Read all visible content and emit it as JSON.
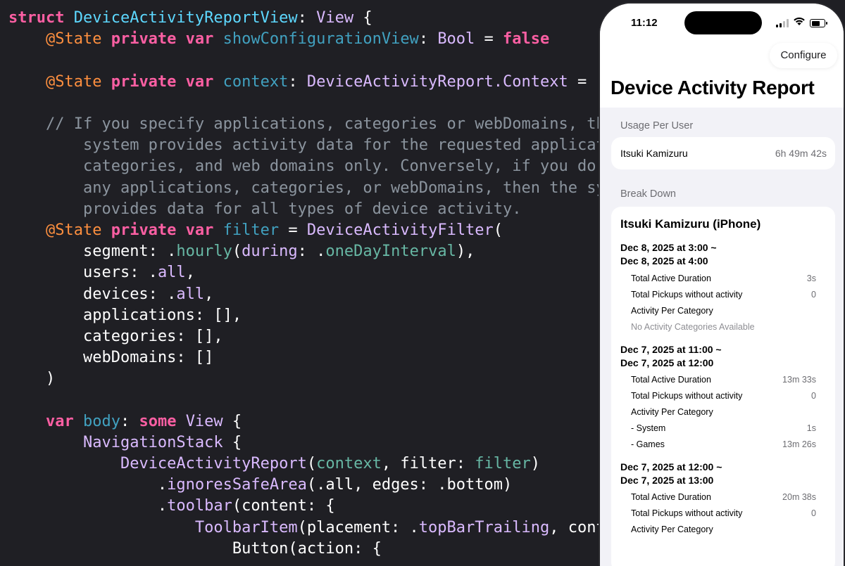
{
  "code": {
    "l1": {
      "kw": "struct ",
      "name": "DeviceActivityReportView",
      "colon": ": ",
      "type": "View",
      "brace": " {"
    },
    "l2": {
      "attr": "@State ",
      "kw1": "private ",
      "kw2": "var ",
      "name": "showConfigurationView",
      "colon": ": ",
      "type": "Bool",
      "eq": " = ",
      "val": "false"
    },
    "l4": {
      "attr": "@State ",
      "kw1": "private ",
      "kw2": "var ",
      "name": "context",
      "colon": ": ",
      "type": "DeviceActivityReport.Context",
      "eq": " = ."
    },
    "l6": "// If you specify applications, categories or webDomains, th",
    "l7": "    system provides activity data for the requested applicat",
    "l8": "    categories, and web domains only. Conversely, if you do ",
    "l9": "    any applications, categories, or webDomains, then the sy",
    "l10": "    provides data for all types of device activity.",
    "l11": {
      "attr": "@State ",
      "kw1": "private ",
      "kw2": "var ",
      "name": "filter",
      "eq": " = ",
      "type": "DeviceActivityFilter",
      "paren": "("
    },
    "l12": {
      "a": "    segment: .",
      "fn": "hourly",
      "b": "(",
      "c": "during",
      "d": ": .",
      "e": "oneDayInterval",
      "f": "),"
    },
    "l13": {
      "a": "    users: .",
      "b": "all",
      "c": ","
    },
    "l14": {
      "a": "    devices: .",
      "b": "all",
      "c": ","
    },
    "l15": "    applications: [],",
    "l16": "    categories: [],",
    "l17": "    webDomains: []",
    "l18": ")",
    "l20": {
      "kw": "var ",
      "name": "body",
      "colon": ": ",
      "kw2": "some ",
      "type": "View",
      "brace": " {"
    },
    "l21": {
      "pad": "    ",
      "type": "NavigationStack",
      "brace": " {"
    },
    "l22": {
      "pad": "        ",
      "type": "DeviceActivityReport",
      "a": "(",
      "b": "context",
      "c": ", filter: ",
      "d": "filter",
      "e": ")"
    },
    "l23": {
      "pad": "            .",
      "fn": "ignoresSafeArea",
      "a": "(.all, edges: .bottom)"
    },
    "l24": {
      "pad": "            .",
      "fn": "toolbar",
      "a": "(content: {"
    },
    "l25": {
      "pad": "                ",
      "type": "ToolbarItem",
      "a": "(placement: .",
      "b": "topBarTrailing",
      "c": ", conten"
    },
    "l26": {
      "pad": "                    ",
      "a": "Button(action: {"
    }
  },
  "phone": {
    "time": "11:12",
    "configure": "Configure",
    "title": "Device Activity Report",
    "usage_header": "Usage Per User",
    "user_name": "Itsuki Kamizuru",
    "user_total": "6h 49m 42s",
    "breakdown_header": "Break Down",
    "device_title": "Itsuki Kamizuru (iPhone)",
    "segments": [
      {
        "range1": "Dec 8, 2025 at 3:00 ~",
        "range2": "Dec 8, 2025 at 4:00",
        "active_label": "Total Active Duration",
        "active": "3s",
        "pickups_label": "Total Pickups without activity",
        "pickups": "0",
        "category_label": "Activity Per Category",
        "empty": "No Activity Categories Available"
      },
      {
        "range1": "Dec 7, 2025 at 11:00 ~",
        "range2": "Dec 7, 2025 at 12:00",
        "active_label": "Total Active Duration",
        "active": "13m 33s",
        "pickups_label": "Total Pickups without activity",
        "pickups": "0",
        "category_label": "Activity Per Category",
        "categories": [
          {
            "name": "- System",
            "value": "1s"
          },
          {
            "name": "- Games",
            "value": "13m 26s"
          }
        ]
      },
      {
        "range1": "Dec 7, 2025 at 12:00 ~",
        "range2": "Dec 7, 2025 at 13:00",
        "active_label": "Total Active Duration",
        "active": "20m 38s",
        "pickups_label": "Total Pickups without activity",
        "pickups": "0",
        "category_label": "Activity Per Category"
      }
    ]
  }
}
